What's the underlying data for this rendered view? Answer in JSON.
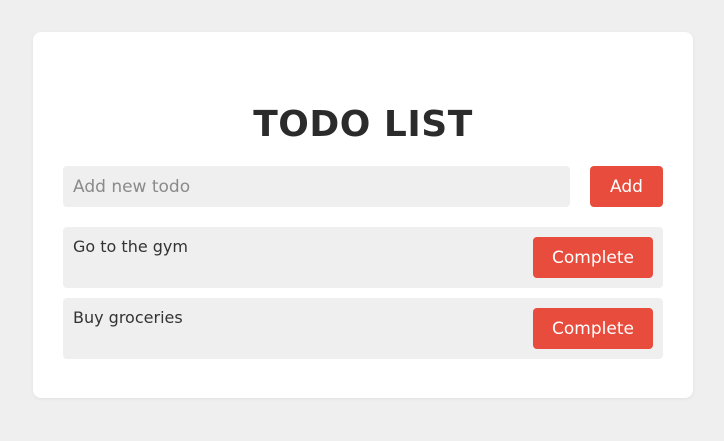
{
  "app": {
    "title": "TODO LIST"
  },
  "add_form": {
    "input_value": "",
    "input_placeholder": "Add new todo",
    "add_label": "Add"
  },
  "todos": [
    {
      "text": "Go to the gym",
      "action_label": "Complete"
    },
    {
      "text": "Buy groceries",
      "action_label": "Complete"
    }
  ],
  "colors": {
    "background": "#efefef",
    "card": "#ffffff",
    "accent": "#e84c3d",
    "title": "#2b2b2b"
  }
}
